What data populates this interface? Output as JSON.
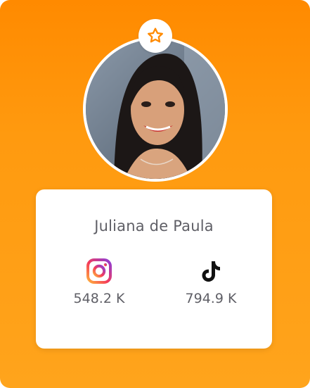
{
  "profile": {
    "name": "Juliana de Paula"
  },
  "stats": {
    "instagram": {
      "icon": "instagram-icon",
      "count": "548.2 K"
    },
    "tiktok": {
      "icon": "tiktok-icon",
      "count": "794.9 K"
    }
  },
  "badge": {
    "icon": "star-icon"
  },
  "colors": {
    "accent": "#FF8A00",
    "text": "#5F5F66",
    "panel": "#FFFFFF"
  }
}
